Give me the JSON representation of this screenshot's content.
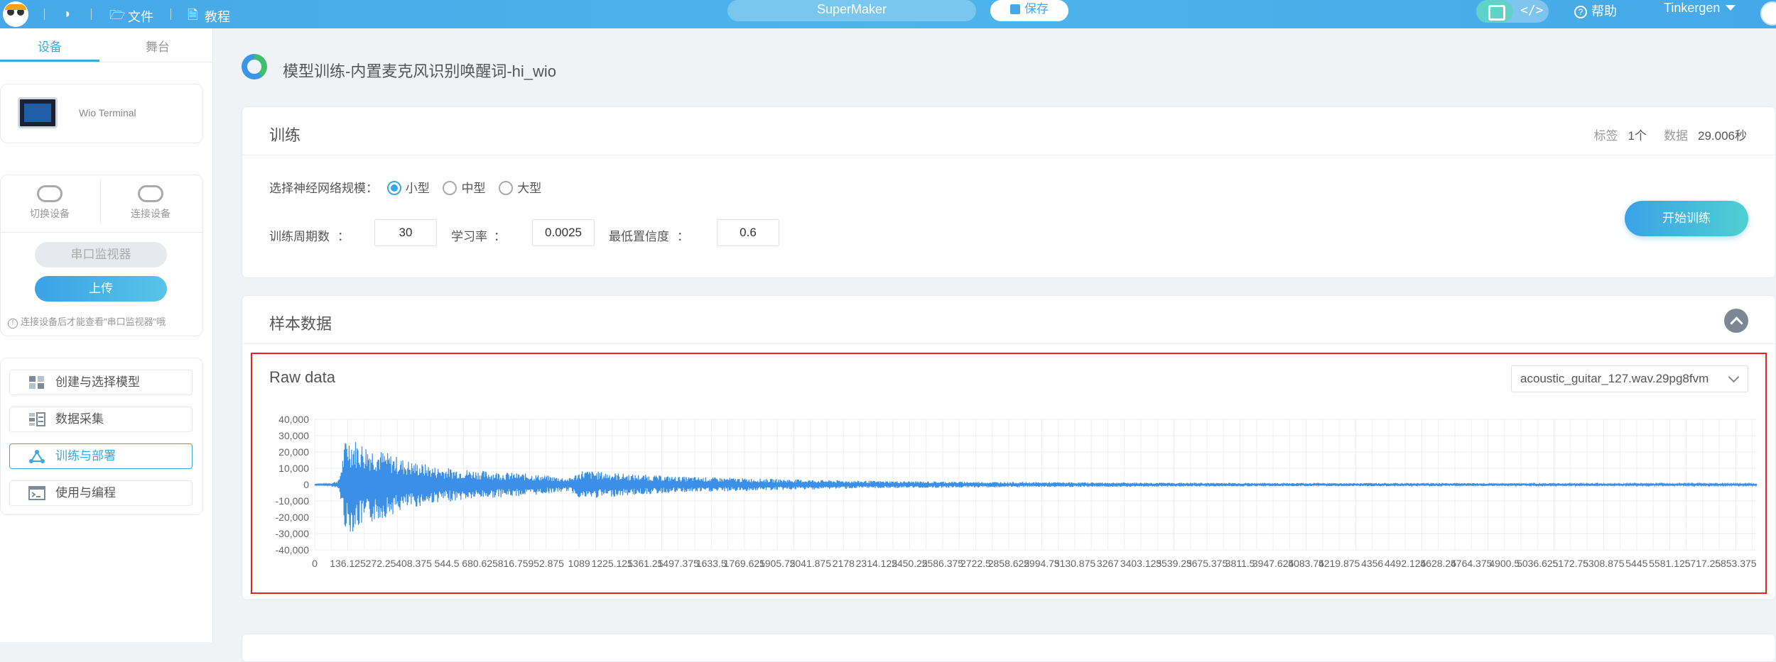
{
  "topbar": {
    "file_label": "文件",
    "tutorial_label": "教程",
    "project_name": "SuperMaker",
    "save_label": "保存",
    "code_toggle": "</>",
    "help_label": "帮助",
    "user_name": "Tinkergen",
    "icons": {
      "globe": "globe-icon",
      "folder": "folder-icon",
      "book": "book-icon",
      "save": "save-icon"
    }
  },
  "sidebar": {
    "tabs": [
      "设备",
      "舞台"
    ],
    "active_tab": 0,
    "device_name": "Wio Terminal",
    "switch_device": "切换设备",
    "connect_device": "连接设备",
    "serial_monitor": "串口监视器",
    "upload": "上传",
    "hint": "连接设备后才能查看\"串口监视器\"哦",
    "menu": [
      {
        "label": "创建与选择模型",
        "icon": "model-grid-icon",
        "active": false
      },
      {
        "label": "数据采集",
        "icon": "data-collect-icon",
        "active": false
      },
      {
        "label": "训练与部署",
        "icon": "network-icon",
        "active": true
      },
      {
        "label": "使用与编程",
        "icon": "terminal-icon",
        "active": false
      }
    ]
  },
  "main": {
    "page_title": "模型训练-内置麦克风识别唤醒词-hi_wio",
    "train": {
      "title": "训练",
      "label_key": "标签",
      "label_value": "1个",
      "data_key": "数据",
      "data_value": "29.006秒",
      "size_prompt": "选择神经网络规模：",
      "sizes": [
        "小型",
        "中型",
        "大型"
      ],
      "size_selected": 0,
      "epochs_label": "训练周期数",
      "epochs_value": "30",
      "lr_label": "学习率",
      "lr_value": "0.0025",
      "conf_label": "最低置信度",
      "conf_value": "0.6",
      "colon": "：",
      "start_button": "开始训练"
    },
    "samples": {
      "title": "样本数据",
      "raw_title": "Raw data",
      "selected_file": "acoustic_guitar_127.wav.29pg8fvm"
    }
  },
  "chart_data": {
    "type": "line",
    "title": "Raw data",
    "ylim": [
      -40000,
      40000
    ],
    "y_ticks": [
      40000,
      30000,
      20000,
      10000,
      0,
      -10000,
      -20000,
      -30000,
      -40000
    ],
    "y_tick_labels": [
      "40,000",
      "30,000",
      "20,000",
      "10,000",
      "0",
      "-10,000",
      "-20,000",
      "-30,000",
      "-40,000"
    ],
    "x_tick_labels": [
      "0",
      "136.125",
      "272.25",
      "408.375",
      "544.5",
      "680.625",
      "816.75",
      "952.875",
      "1089",
      "1225.125",
      "1361.25",
      "1497.375",
      "1633.5",
      "1769.625",
      "1905.75",
      "2041.875",
      "2178",
      "2314.125",
      "2450.25",
      "2586.375",
      "2722.5",
      "2858.625",
      "2994.75",
      "3130.875",
      "3267",
      "3403.125",
      "3539.25",
      "3675.375",
      "3811.5",
      "3947.625",
      "4083.75",
      "4219.875",
      "4356",
      "4492.125",
      "4628.25",
      "4764.375",
      "4900.5",
      "5036.625",
      "5172.75",
      "5308.875",
      "5445",
      "5581.125",
      "5717.25",
      "5853.375"
    ],
    "xlim": [
      0,
      5940
    ],
    "grid": true,
    "color": "#3b8fe6",
    "envelope": {
      "x": [
        0,
        60,
        100,
        130,
        180,
        260,
        360,
        500,
        700,
        900,
        1050,
        1100,
        1300,
        1500,
        1700,
        1900,
        2200,
        2500,
        3000,
        3500,
        4000,
        4500,
        5000,
        5500,
        5940
      ],
      "amplitude": [
        400,
        500,
        3000,
        31000,
        27000,
        22000,
        16000,
        11000,
        8500,
        6500,
        4000,
        9000,
        6500,
        5000,
        4200,
        3500,
        2500,
        2000,
        1500,
        1200,
        1000,
        900,
        800,
        700,
        600
      ]
    }
  }
}
